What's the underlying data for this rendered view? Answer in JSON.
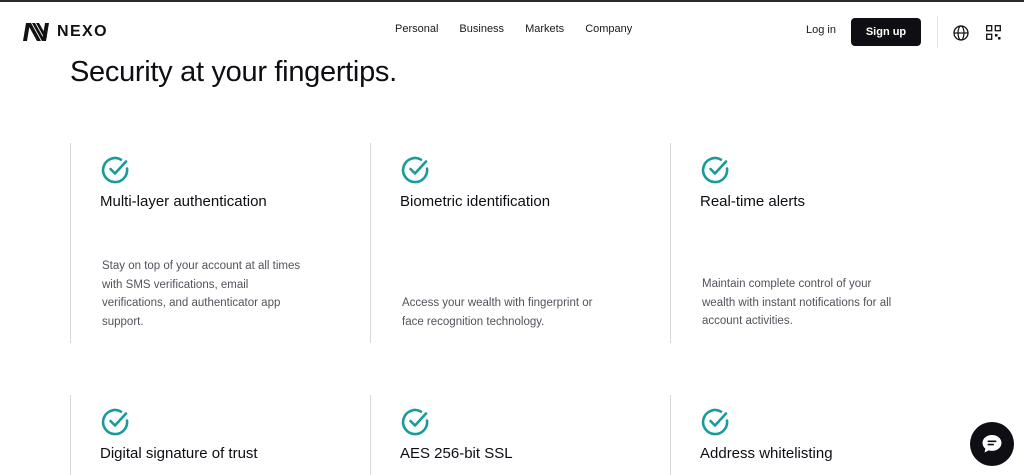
{
  "brand": {
    "name": "NEXO"
  },
  "nav": {
    "items": [
      "Personal",
      "Business",
      "Markets",
      "Company"
    ]
  },
  "header": {
    "login_label": "Log in",
    "signup_label": "Sign up"
  },
  "icons": {
    "logo": "nexo-logo-icon",
    "globe": "globe-icon",
    "qr": "qr-code-icon",
    "check": "check-circle-icon",
    "chat": "chat-bubble-icon"
  },
  "colors": {
    "accent": "#1a9a9a",
    "dark": "#0e0e14"
  },
  "section": {
    "title": "Security at your fingertips."
  },
  "features": [
    {
      "title": "Multi-layer authentication",
      "description": "Stay on top of your account at all times with SMS verifications, email verifications, and authenticator app support."
    },
    {
      "title": "Biometric identification",
      "description": "Access your wealth with fingerprint or face recognition technology."
    },
    {
      "title": "Real-time alerts",
      "description": "Maintain complete control of your wealth with instant notifications for all account activities."
    },
    {
      "title": "Digital signature of trust",
      "description": ""
    },
    {
      "title": "AES 256-bit SSL",
      "description": ""
    },
    {
      "title": "Address whitelisting",
      "description": ""
    }
  ]
}
